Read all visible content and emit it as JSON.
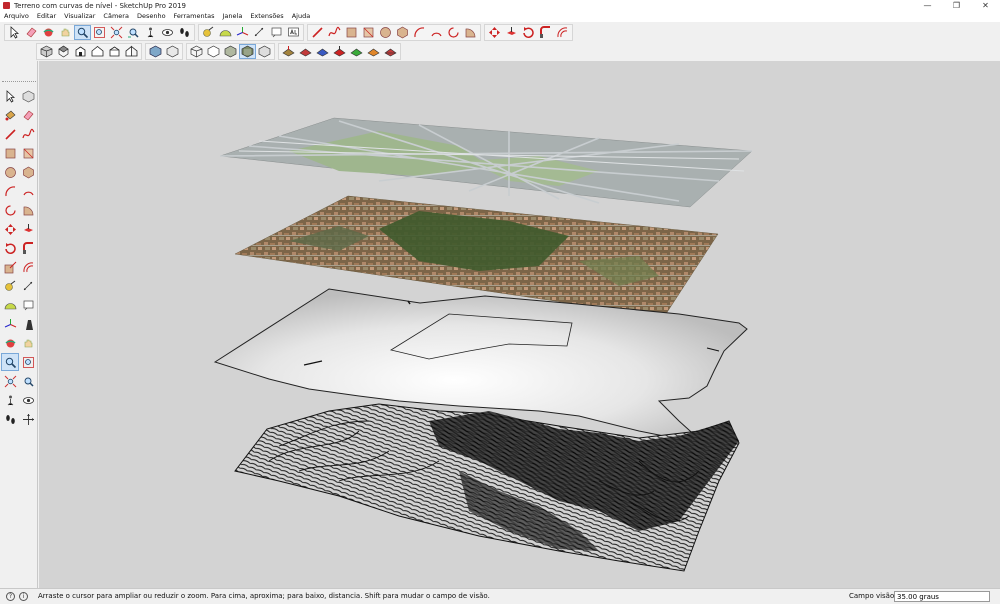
{
  "window": {
    "title": "Terreno com curvas de nível - SketchUp Pro 2019",
    "minimize_glyph": "—",
    "restore_glyph": "❐",
    "close_glyph": "✕"
  },
  "menu": [
    "Arquivo",
    "Editar",
    "Visualizar",
    "Câmera",
    "Desenho",
    "Ferramentas",
    "Janela",
    "Extensões",
    "Ajuda"
  ],
  "toolbar_icons": {
    "row1_group1": [
      "select-icon",
      "eraser-icon",
      "orbit-icon",
      "pan-icon",
      "zoom-icon",
      "zoom-window-icon",
      "zoom-extents-icon",
      "previous-view-icon",
      "position-camera-icon",
      "look-around-icon",
      "walk-icon"
    ],
    "row1_group2": [
      "tape-measure-icon",
      "protractor-icon",
      "axes-icon",
      "dimension-icon",
      "text-icon",
      "3d-text-icon"
    ],
    "row1_group3": [
      "line-icon",
      "freehand-icon",
      "rectangle-icon",
      "rotated-rectangle-icon",
      "circle-icon",
      "polygon-icon",
      "arc-icon",
      "two-point-arc-icon",
      "three-point-arc-icon",
      "pie-icon"
    ],
    "row1_group4": [
      "move-icon",
      "push-pull-icon",
      "rotate-icon",
      "follow-me-icon",
      "offset-icon"
    ],
    "row2_group1": [
      "iso-view-icon",
      "top-view-icon",
      "front-view-icon",
      "right-view-icon",
      "back-view-icon",
      "left-view-icon"
    ],
    "row2_group2": [
      "xray-icon",
      "back-edges-icon"
    ],
    "row2_group3": [
      "wireframe-icon",
      "hidden-line-icon",
      "shaded-icon",
      "shaded-textures-icon",
      "monochrome-icon"
    ],
    "row2_group4": [
      "sandbox-contours-icon",
      "sandbox-scratch-icon",
      "sandbox-smoove-icon",
      "sandbox-stamp-icon",
      "sandbox-drape-icon",
      "sandbox-add-detail-icon",
      "sandbox-flip-edge-icon"
    ]
  },
  "status": {
    "message": "Arraste o cursor para ampliar ou reduzir o zoom. Para cima, aproxima; para baixo, distancia. Shift para mudar o campo de visão.",
    "vcb_label": "Campo visão",
    "vcb_value": "35.00 graus",
    "help_glyph": "?",
    "info_glyph": "i"
  },
  "colors": {
    "viewport_bg": "#d3d3d3",
    "map_land": "#a9b3a5",
    "map_park": "#9fb68e",
    "satellite_base": "#6e5a3e",
    "terrain_fill": "#ededed",
    "contour_stroke": "#111111"
  }
}
